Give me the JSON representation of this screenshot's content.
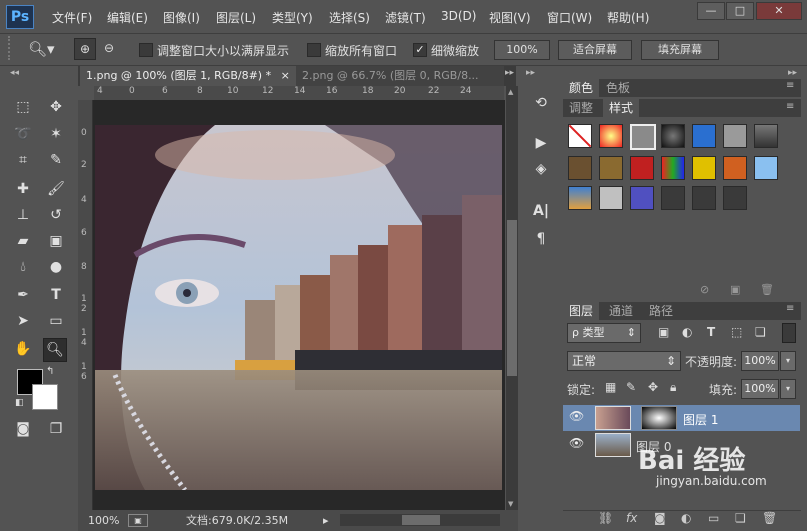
{
  "app": {
    "logo": "Ps"
  },
  "menu": {
    "items": [
      "文件(F)",
      "编辑(E)",
      "图像(I)",
      "图层(L)",
      "类型(Y)",
      "选择(S)",
      "滤镜(T)",
      "3D(D)",
      "视图(V)",
      "窗口(W)",
      "帮助(H)"
    ]
  },
  "window_controls": {
    "minimize": "—",
    "maximize": "□",
    "close": "✕"
  },
  "options": {
    "resize_windows_label": "调整窗口大小以满屏显示",
    "zoom_all_label": "缩放所有窗口",
    "scrubby_zoom_label": "细微缩放",
    "scrubby_zoom_checked": true,
    "percent_button": "100%",
    "fit_screen_button": "适合屏幕",
    "fill_screen_button": "填充屏幕"
  },
  "tabs": [
    {
      "label": "1.png @ 100% (图层 1, RGB/8#) *",
      "close": "×"
    },
    {
      "label": "2.png @ 66.7% (图层 0, RGB/8...",
      "close": ""
    }
  ],
  "ruler": {
    "top": [
      "4",
      "0",
      "6",
      "8",
      "10",
      "12",
      "14",
      "16",
      "18",
      "20",
      "22",
      "24"
    ],
    "left": [
      "0",
      "2",
      "4",
      "6",
      "8",
      "1",
      "2",
      "1",
      "4",
      "1",
      "6"
    ]
  },
  "status": {
    "zoom": "100%",
    "doc_info": "文档:679.0K/2.35M"
  },
  "color_panel": {
    "tabs": [
      "颜色",
      "色板"
    ],
    "subtabs": [
      "调整",
      "样式"
    ]
  },
  "styles_swatches": [
    "#ffffff",
    "#d42020",
    "#8a8a8a",
    "#222222",
    "#2a6fd0",
    "#9a9a9a",
    "#4a4a4a",
    "#6a5030",
    "#8a6a30",
    "#c02020",
    "#3060c0",
    "#e0c000",
    "#d06020",
    "#8ac0f0",
    "#4060a0",
    "#c0c0c0",
    "#5050c0",
    "#3a3a3a",
    "#3a3a3a",
    "#3a3a3a"
  ],
  "layers_panel": {
    "tabs": [
      "图层",
      "通道",
      "路径"
    ],
    "filter_label": "ρ 类型",
    "blend_mode": "正常",
    "opacity_label": "不透明度:",
    "opacity": "100%",
    "lock_label": "锁定:",
    "fill_label": "填充:",
    "fill": "100%",
    "layers": [
      {
        "name": "图层 1",
        "selected": true
      },
      {
        "name": "图层 0",
        "selected": false
      }
    ]
  },
  "watermark": {
    "brand": "Bai 经验",
    "url": "jingyan.baidu.com"
  }
}
